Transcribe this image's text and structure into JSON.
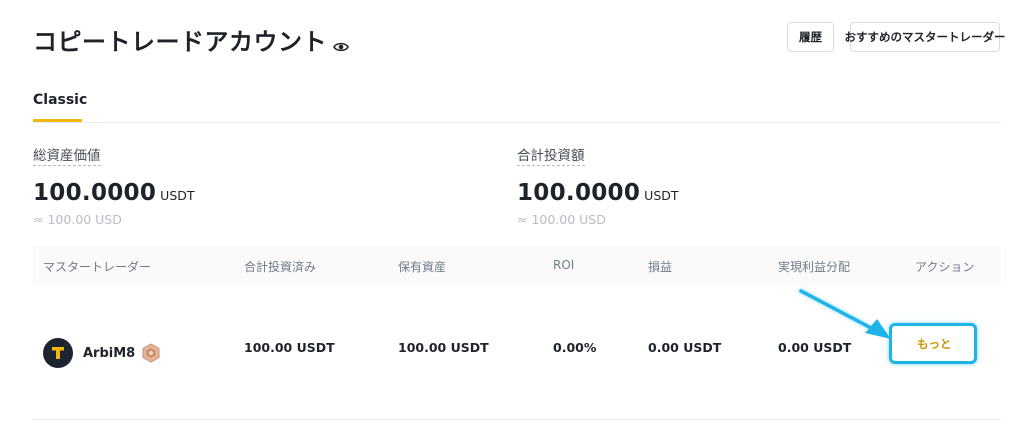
{
  "header": {
    "title": "コピートレードアカウント",
    "history_label": "履歴",
    "recommend_label": "おすすめのマスタートレーダー"
  },
  "tabs": [
    {
      "label": "Classic",
      "active": true
    }
  ],
  "stats": {
    "total_assets": {
      "label": "総資産価値",
      "value": "100.0000",
      "unit": "USDT",
      "sub": "≈ 100.00 USD"
    },
    "total_invested": {
      "label": "合計投資額",
      "value": "100.0000",
      "unit": "USDT",
      "sub": "≈ 100.00 USD"
    }
  },
  "table": {
    "columns": [
      "マスタートレーダー",
      "合計投資済み",
      "保有資産",
      "ROI",
      "損益",
      "実現利益分配",
      "アクション"
    ],
    "rows": [
      {
        "trader": "ArbiM8",
        "invested": "100.00 USDT",
        "holdings": "100.00 USDT",
        "roi": "0.00%",
        "pnl": "0.00 USDT",
        "profit_share": "0.00 USDT",
        "action": "もっと"
      }
    ]
  },
  "colors": {
    "accent": "#f0b90b",
    "highlight": "#1fb4e8",
    "action_text": "#c99400"
  },
  "icons": {
    "title_icon": "eye-icon",
    "trader_badge": "bronze-badge-icon"
  }
}
